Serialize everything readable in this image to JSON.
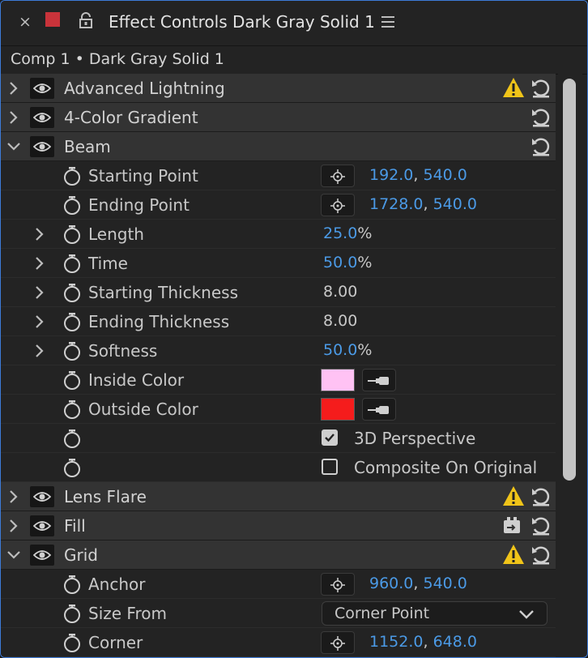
{
  "window": {
    "title": "Effect Controls Dark Gray Solid 1",
    "close_glyph": "×",
    "layer_color": "#c9333a",
    "icons": [
      "close-icon",
      "lock-icon",
      "panel-menu-icon"
    ]
  },
  "breadcrumb": {
    "text": "Comp 1 • Dark Gray Solid 1"
  },
  "accent_color": "#4b9ae6",
  "effects": [
    {
      "name": "Advanced Lightning",
      "expanded": false,
      "warning": true,
      "icons": [
        "warning-icon",
        "reset-icon"
      ]
    },
    {
      "name": "4-Color Gradient",
      "expanded": false,
      "warning": false,
      "icons": [
        "reset-icon"
      ]
    },
    {
      "name": "Beam",
      "expanded": true,
      "warning": false,
      "icons": [
        "reset-icon"
      ]
    },
    {
      "name": "Lens Flare",
      "expanded": false,
      "warning": true,
      "icons": [
        "warning-icon",
        "reset-icon"
      ]
    },
    {
      "name": "Fill",
      "expanded": false,
      "warning": false,
      "icons": [
        "mask-icon",
        "reset-icon"
      ]
    },
    {
      "name": "Grid",
      "expanded": true,
      "warning": true,
      "icons": [
        "warning-icon",
        "reset-icon"
      ]
    }
  ],
  "beam": {
    "starting_point": {
      "label": "Starting Point",
      "x": "192.0",
      "y": "540.0"
    },
    "ending_point": {
      "label": "Ending Point",
      "x": "1728.0",
      "y": "540.0"
    },
    "length": {
      "label": "Length",
      "value": "25.0",
      "unit": "%"
    },
    "time": {
      "label": "Time",
      "value": "50.0",
      "unit": "%"
    },
    "starting_thickness": {
      "label": "Starting Thickness",
      "value": "8.00"
    },
    "ending_thickness": {
      "label": "Ending Thickness",
      "value": "8.00"
    },
    "softness": {
      "label": "Softness",
      "value": "50.0",
      "unit": "%"
    },
    "inside_color": {
      "label": "Inside Color",
      "color": "#ffc2f4"
    },
    "outside_color": {
      "label": "Outside Color",
      "color": "#f51c1c"
    },
    "perspective_3d": {
      "label": "3D Perspective",
      "checked": true
    },
    "composite_on_original": {
      "label": "Composite On Original",
      "checked": false
    }
  },
  "grid": {
    "anchor": {
      "label": "Anchor",
      "x": "960.0",
      "y": "540.0"
    },
    "size_from": {
      "label": "Size From",
      "selected": "Corner Point"
    },
    "corner": {
      "label": "Corner",
      "x": "1152.0",
      "y": "648.0"
    }
  },
  "separators": {
    "comma": ", "
  }
}
